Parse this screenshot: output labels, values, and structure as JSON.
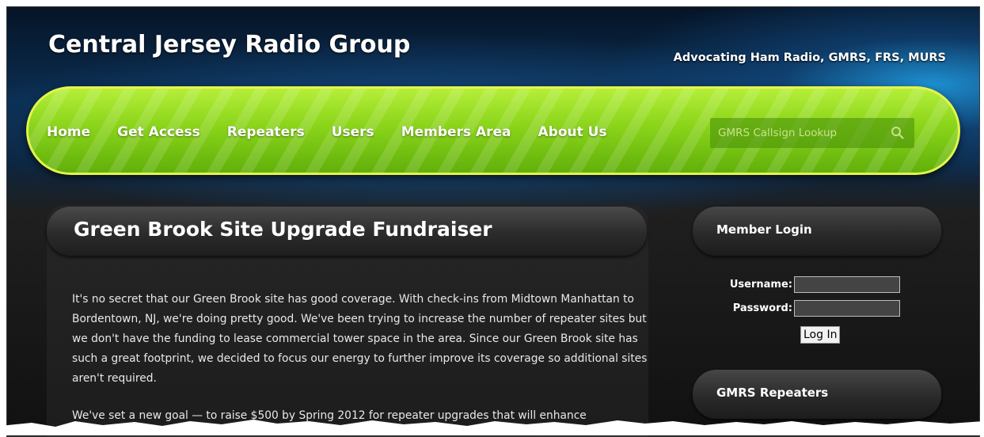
{
  "header": {
    "site_title": "Central Jersey Radio Group",
    "tagline": "Advocating Ham Radio, GMRS, FRS, MURS"
  },
  "nav": {
    "items": [
      {
        "label": "Home"
      },
      {
        "label": "Get Access"
      },
      {
        "label": "Repeaters"
      },
      {
        "label": "Users"
      },
      {
        "label": "Members Area"
      },
      {
        "label": "About Us"
      }
    ],
    "search": {
      "placeholder": "GMRS Callsign Lookup",
      "icon": "search-icon"
    }
  },
  "main": {
    "title": "Green Brook Site Upgrade Fundraiser",
    "paragraphs": [
      "It's no secret that our Green Brook site has good coverage. With check-ins from Midtown Manhattan to Bordentown, NJ, we're doing pretty good. We've been trying to increase the number of repeater sites but we don't have the funding to lease commercial tower space in the area. Since our Green Brook site has such a great footprint, we decided to focus our energy to further improve its coverage so additional sites aren't required.",
      "We've set a new goal — to raise $500 by Spring 2012 for repeater upgrades that will enhance"
    ]
  },
  "sidebar": {
    "login": {
      "heading": "Member Login",
      "username_label": "Username:",
      "password_label": "Password:",
      "button_label": "Log In"
    },
    "repeaters": {
      "heading": "GMRS Repeaters"
    }
  },
  "colors": {
    "nav_green": "#8ad41a",
    "nav_border": "#e4f44a",
    "header_blue": "#1d8fd0",
    "panel_dark": "#262626"
  }
}
